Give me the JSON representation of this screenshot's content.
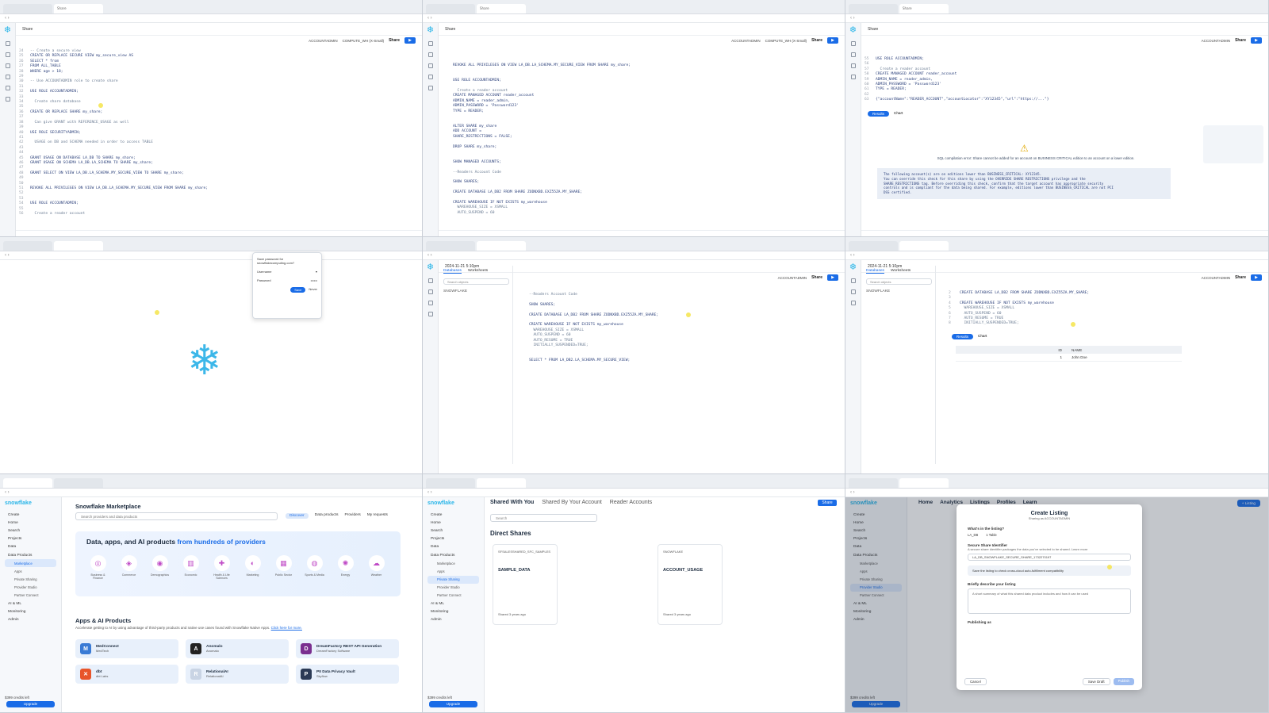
{
  "tiles": {
    "t1": {
      "tab_title": "Share",
      "toolbar": {
        "role": "ACCOUNTADMIN",
        "warehouse": "COMPUTE_WH (X-Small)",
        "share": "Share"
      },
      "lines": [
        {
          "n": "24",
          "code": "-- Create a secure view"
        },
        {
          "n": "25",
          "code": "CREATE OR REPLACE SECURE VIEW my_secure_view AS"
        },
        {
          "n": "26",
          "code": "SELECT * from"
        },
        {
          "n": "27",
          "code": "FROM ALL_TABLE"
        },
        {
          "n": "28",
          "code": "WHERE age > 18;"
        },
        {
          "n": "29",
          "code": ""
        },
        {
          "n": "30",
          "code": "-- Use ACCOUNTADMIN role to create share"
        },
        {
          "n": "31",
          "code": ""
        },
        {
          "n": "32",
          "code": "USE ROLE ACCOUNTADMIN;"
        },
        {
          "n": "33",
          "code": ""
        },
        {
          "n": "34",
          "code": "  Create share database"
        },
        {
          "n": "35",
          "code": ""
        },
        {
          "n": "36",
          "code": "CREATE OR REPLACE SHARE my_share;"
        },
        {
          "n": "37",
          "code": ""
        },
        {
          "n": "38",
          "code": "  Can give GRANT with REFERENCE_USAGE as well"
        },
        {
          "n": "39",
          "code": ""
        },
        {
          "n": "40",
          "code": "USE ROLE SECURITYADMIN;"
        },
        {
          "n": "41",
          "code": ""
        },
        {
          "n": "42",
          "code": "  USAGE on DB and SCHEMA needed in order to access TABLE"
        },
        {
          "n": "43",
          "code": ""
        },
        {
          "n": "44",
          "code": ""
        },
        {
          "n": "45",
          "code": "GRANT USAGE ON DATABASE LA_DB TO SHARE my_share;"
        },
        {
          "n": "46",
          "code": "GRANT USAGE ON SCHEMA LA_DB.LA_SCHEMA TO SHARE my_share;"
        },
        {
          "n": "47",
          "code": ""
        },
        {
          "n": "48",
          "code": "GRANT SELECT ON VIEW LA_DB.LA_SCHEMA.MY_SECURE_VIEW TO SHARE my_share;"
        },
        {
          "n": "49",
          "code": ""
        },
        {
          "n": "50",
          "code": ""
        },
        {
          "n": "51",
          "code": "REVOKE ALL PRIVILEGES ON VIEW LA_DB.LA_SCHEMA.MY_SECURE_VIEW FROM SHARE my_share;"
        },
        {
          "n": "52",
          "code": ""
        },
        {
          "n": "53",
          "code": ""
        },
        {
          "n": "54",
          "code": "USE ROLE ACCOUNTADMIN;"
        },
        {
          "n": "55",
          "code": ""
        },
        {
          "n": "56",
          "code": "  Create a reader account"
        }
      ]
    },
    "t2": {
      "lines": [
        {
          "n": "",
          "code": "REVOKE ALL PRIVILEGES ON VIEW LA_DB.LA_SCHEMA.MY_SECURE_VIEW FROM SHARE my_share;"
        },
        {
          "n": "",
          "code": ""
        },
        {
          "n": "",
          "code": ""
        },
        {
          "n": "",
          "code": "USE ROLE ACCOUNTADMIN;"
        },
        {
          "n": "",
          "code": ""
        },
        {
          "n": "",
          "code": "  Create a reader account"
        },
        {
          "n": "",
          "code": "CREATE MANAGED ACCOUNT reader_account"
        },
        {
          "n": "",
          "code": "ADMIN_NAME = reader_admin,"
        },
        {
          "n": "",
          "code": "ADMIN_PASSWORD = 'Password123'"
        },
        {
          "n": "",
          "code": "TYPE = READER;"
        },
        {
          "n": "",
          "code": ""
        },
        {
          "n": "",
          "code": ""
        },
        {
          "n": "",
          "code": "ALTER SHARE my_share"
        },
        {
          "n": "",
          "code": "ADD ACCOUNT ="
        },
        {
          "n": "",
          "code": "SHARE_RESTRICTIONS = FALSE;"
        },
        {
          "n": "",
          "code": ""
        },
        {
          "n": "",
          "code": "DROP SHARE my_share;"
        },
        {
          "n": "",
          "code": ""
        },
        {
          "n": "",
          "code": ""
        },
        {
          "n": "",
          "code": "SHOW MANAGED ACCOUNTS;"
        },
        {
          "n": "",
          "code": ""
        },
        {
          "n": "",
          "code": "--Readers Account Code"
        },
        {
          "n": "",
          "code": ""
        },
        {
          "n": "",
          "code": "SHOW SHARES;"
        },
        {
          "n": "",
          "code": ""
        },
        {
          "n": "",
          "code": "CREATE DATABASE LA_DB2 FROM SHARE ZODNXBD.EXZ55ZA.MY_SHARE;"
        },
        {
          "n": "",
          "code": ""
        },
        {
          "n": "",
          "code": "CREATE WAREHOUSE IF NOT EXISTS my_warehouse"
        },
        {
          "n": "",
          "code": "  WAREHOUSE_SIZE = XSMALL"
        },
        {
          "n": "",
          "code": "  AUTO_SUSPEND = 60"
        }
      ]
    },
    "t3": {
      "lines": [
        {
          "n": "55",
          "code": "USE ROLE ACCOUNTADMIN;"
        },
        {
          "n": "56",
          "code": ""
        },
        {
          "n": "57",
          "code": "  Create a reader account"
        },
        {
          "n": "58",
          "code": "CREATE MANAGED ACCOUNT reader_account"
        },
        {
          "n": "59",
          "code": "ADMIN_NAME = reader_admin,"
        },
        {
          "n": "60",
          "code": "ADMIN_PASSWORD = 'Password123'"
        },
        {
          "n": "61",
          "code": "TYPE = READER;"
        },
        {
          "n": "62",
          "code": ""
        },
        {
          "n": "63",
          "code": "{\"accountName\":\"READER_ACCOUNT\",\"accountLocator\":\"XY12345\",\"url\":\"https://...\"}"
        }
      ],
      "results_label": "Results",
      "chart_label": "Chart",
      "warning": "SQL compilation error: Share cannot be added for an account on BUSINESS CRITICAL edition to an account on a lower edition.",
      "warn_detail": "The following account(s) are on editions lower than BUSINESS_CRITICAL: XY12345.\nYou can override this check for this share by using the OVERRIDE SHARE RESTRICTIONS privilege and the\nSHARE_RESTRICTIONS tag. Before overriding this check, confirm that the target account has appropriate security\ncontrols and is compliant for the data being shared. For example, editions lower than BUSINESS_CRITICAL are not PCI\nDSS certified."
    },
    "t4": {
      "login": {
        "title": "Save password for snowflakecomputing.com?",
        "user": "Username",
        "pass": "Password",
        "save": "Save",
        "never": "Never"
      }
    },
    "t5": {
      "tab_title": "2024-11-21 5:10pm",
      "side_tabs": [
        "Databases",
        "Worksheets"
      ],
      "search": "Search objects",
      "node": "SNOWFLAKE",
      "lines": [
        {
          "n": "",
          "code": "--Readers Account Code"
        },
        {
          "n": "",
          "code": ""
        },
        {
          "n": "",
          "code": "SHOW SHARES;"
        },
        {
          "n": "",
          "code": ""
        },
        {
          "n": "",
          "code": "CREATE DATABASE LA_DB2 FROM SHARE ZODNXBD.EXZ55ZA.MY_SHARE;"
        },
        {
          "n": "",
          "code": ""
        },
        {
          "n": "",
          "code": "CREATE WAREHOUSE IF NOT EXISTS my_warehouse"
        },
        {
          "n": "",
          "code": "  WAREHOUSE_SIZE = XSMALL"
        },
        {
          "n": "",
          "code": "  AUTO_SUSPEND = 60"
        },
        {
          "n": "",
          "code": "  AUTO_RESUME = TRUE"
        },
        {
          "n": "",
          "code": "  INITIALLY_SUSPENDED=TRUE;"
        },
        {
          "n": "",
          "code": ""
        },
        {
          "n": "",
          "code": ""
        },
        {
          "n": "",
          "code": "SELECT * FROM LA_DB2.LA_SCHEMA.MY_SECURE_VIEW;"
        }
      ]
    },
    "t6": {
      "lines": [
        {
          "n": "2",
          "code": "CREATE DATABASE LA_DB2 FROM SHARE ZODNXBD.EXZ55ZA.MY_SHARE;"
        },
        {
          "n": "3",
          "code": ""
        },
        {
          "n": "4",
          "code": "CREATE WAREHOUSE IF NOT EXISTS my_warehouse"
        },
        {
          "n": "5",
          "code": "  WAREHOUSE_SIZE = XSMALL"
        },
        {
          "n": "6",
          "code": "  AUTO_SUSPEND = 60"
        },
        {
          "n": "7",
          "code": "  AUTO_RESUME = TRUE"
        },
        {
          "n": "8",
          "code": "  INITIALLY_SUSPENDED=TRUE;"
        }
      ],
      "cols": [
        "ID",
        "NAME"
      ],
      "rows": [
        [
          "1",
          "John Doe"
        ]
      ]
    },
    "t7": {
      "brand": "snowflake",
      "nav": [
        "Create",
        "Home",
        "Search",
        "Projects",
        "Data",
        "Data Products",
        "Marketplace",
        "Apps",
        "Private Sharing",
        "Provider Studio",
        "Partner Connect",
        "AI & ML",
        "Monitoring",
        "Admin"
      ],
      "trial": "$399 credits left",
      "upgrade": "Upgrade",
      "title": "Snowflake Marketplace",
      "search": "Search providers and data products",
      "tabs": [
        "Discover",
        "Data products",
        "Providers",
        "My requests"
      ],
      "hero_a": "Data, apps, and AI products ",
      "hero_b": "from hundreds of providers",
      "cats": [
        "Business & Finance",
        "Commerce",
        "Demographics",
        "Economic",
        "Health & Life Sciences",
        "Marketing",
        "Public Sector",
        "Sports & Media",
        "Energy",
        "Weather"
      ],
      "apps_title": "Apps & AI Products",
      "apps_sub": "Accelerate getting to AI by using advantage of third-party products and native use cases found with Snowflake Native Apps.",
      "apps_link": "Click here for more.",
      "cards": [
        {
          "t": "MedConnect",
          "s": "MedTech"
        },
        {
          "t": "Anomalo",
          "s": "Anomalo"
        },
        {
          "t": "DreamFactory REST API Generation",
          "s": "DreamFactory Software"
        },
        {
          "t": "dbt",
          "s": "dbt Labs"
        },
        {
          "t": "RelationalAI",
          "s": "RelationalAI"
        },
        {
          "t": "PII Data Privacy Vault",
          "s": "Skyflow"
        }
      ]
    },
    "t8": {
      "tabs": [
        "Shared With You",
        "Shared By Your Account",
        "Reader Accounts"
      ],
      "share": "Share",
      "search": "Search",
      "title": "Direct Shares",
      "cards": [
        {
          "sub": "SFSALESSHARED_SFC_SAMPLES",
          "name": "SAMPLE_DATA",
          "date": "Shared 3 years ago"
        },
        {
          "sub": "SNOWFLAKE",
          "name": "ACCOUNT_USAGE",
          "date": "Shared 3 years ago"
        }
      ]
    },
    "t9": {
      "topnav": [
        "Home",
        "Analytics",
        "Listings",
        "Profiles",
        "Learn"
      ],
      "listing": "+ Listing",
      "modal_title": "Create Listing",
      "modal_role": "Sharing as ACCOUNTADMIN",
      "what": "What's in the listing?",
      "db": "LA_DB",
      "view": "1 Table",
      "ident": "Secure Share Identifier",
      "ident_desc": "A secure share identifier packages the data you've selected to be shared. Learn more",
      "ident_val": "LA_DB_SNOWFLAKE_SECURE_SHARE_1732270197",
      "note": "Save the listing to check cross-cloud auto-fulfillment compatibility",
      "desc_lbl": "Briefly describe your listing",
      "desc_ph": "A short summary of what this shared data product includes and how it can be used",
      "pub": "Publishing as",
      "cancel": "Cancel",
      "save": "Save Draft",
      "publish": "Publish"
    }
  }
}
